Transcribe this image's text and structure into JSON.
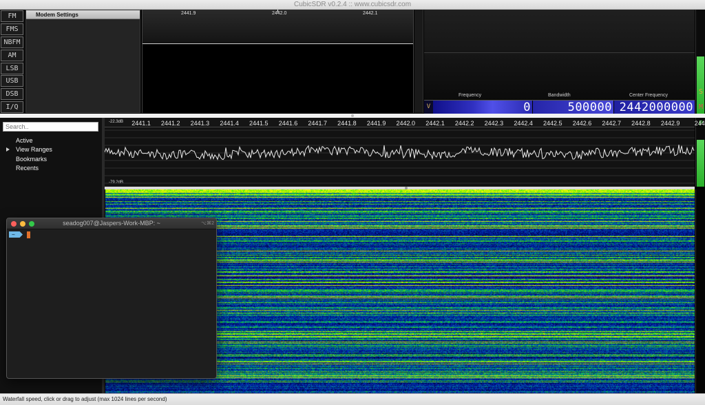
{
  "window": {
    "title": "CubicSDR v0.2.4 :: www.cubicsdr.com"
  },
  "modes": [
    "FM",
    "FMS",
    "NBFM",
    "AM",
    "LSB",
    "USB",
    "DSB",
    "I/Q"
  ],
  "modem_settings": {
    "title": "Modem Settings"
  },
  "demod_scope": {
    "ticks": [
      "2441.9",
      "2442.0",
      "2442.1"
    ]
  },
  "freq_panel": {
    "labels": {
      "frequency": "Frequency",
      "bandwidth": "Bandwidth",
      "center": "Center Frequency"
    },
    "v_label": "V",
    "frequency_value": "0",
    "bandwidth_value": "500000",
    "center_value": "2442000000"
  },
  "side_meters": {
    "s_label": "S",
    "m_label": "M",
    "p_label": "P",
    "s_level": 0.55,
    "p_level": 0.68,
    "colors": {
      "s": "#e6a23c",
      "m": "#e05050",
      "p": "#59d459"
    }
  },
  "bookmarks": {
    "search_placeholder": "Search..",
    "items": [
      "Active",
      "View Ranges",
      "Bookmarks",
      "Recents"
    ]
  },
  "spectrum": {
    "ticks": [
      "2441.1",
      "2441.2",
      "2441.3",
      "2441.4",
      "2441.5",
      "2441.6",
      "2441.7",
      "2441.8",
      "2441.9",
      "2442.0",
      "2442.1",
      "2442.2",
      "2442.3",
      "2442.4",
      "2442.5",
      "2442.6",
      "2442.7",
      "2442.8",
      "2442.9",
      "244"
    ],
    "db_top": "-22.3dB",
    "db_bottom": "-79.2dB"
  },
  "terminal": {
    "title": "seadog007@Jaspers-Work-MBP: ~",
    "shortcut": "⌥⌘2",
    "prompt": "~"
  },
  "status": {
    "text": "Waterfall speed, click or drag to adjust (max 1024 lines per second)"
  }
}
